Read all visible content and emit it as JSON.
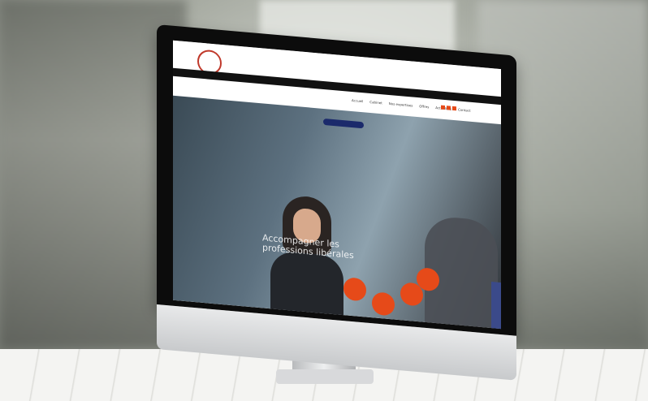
{
  "scene": {
    "description_label": "",
    "site": {
      "nav_items": [
        "Accueil",
        "Cabinet",
        "Nos expertises",
        "Offres",
        "Actualités",
        "Contact"
      ],
      "cta_label": "",
      "hero_title": "Accompagner les professions libérales",
      "hero_text": "",
      "bubbles": [
        "",
        "",
        "",
        ""
      ]
    }
  }
}
